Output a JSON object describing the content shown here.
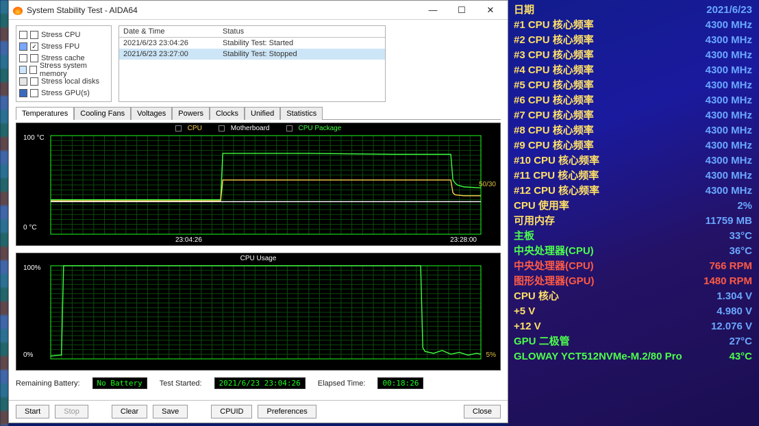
{
  "window": {
    "title": "System Stability Test - AIDA64",
    "min_glyph": "—",
    "max_glyph": "☐",
    "close_glyph": "✕"
  },
  "stress_options": [
    {
      "swatch": "#ffffff",
      "checked": false,
      "label": "Stress CPU"
    },
    {
      "swatch": "#7aa7ff",
      "checked": true,
      "label": "Stress FPU"
    },
    {
      "swatch": "#ffffff",
      "checked": false,
      "label": "Stress cache"
    },
    {
      "swatch": "#cce6ff",
      "checked": false,
      "label": "Stress system memory"
    },
    {
      "swatch": "#e6e6e6",
      "checked": false,
      "label": "Stress local disks"
    },
    {
      "swatch": "#3a6abf",
      "checked": false,
      "label": "Stress GPU(s)"
    }
  ],
  "log": {
    "headers": {
      "col1": "Date & Time",
      "col2": "Status"
    },
    "rows": [
      {
        "c1": "2021/6/23 23:04:26",
        "c2": "Stability Test: Started"
      },
      {
        "c1": "2021/6/23 23:27:00",
        "c2": "Stability Test: Stopped"
      }
    ]
  },
  "tabs": [
    "Temperatures",
    "Cooling Fans",
    "Voltages",
    "Powers",
    "Clocks",
    "Unified",
    "Statistics"
  ],
  "chart_data": [
    {
      "type": "line",
      "title": "",
      "legend": [
        "CPU",
        "Motherboard",
        "CPU Package"
      ],
      "legend_colors": [
        "#ffd050",
        "#ffffff",
        "#40ff40"
      ],
      "yticks": [
        "100 °C",
        "0 °C"
      ],
      "ylim": [
        0,
        100
      ],
      "xticks": [
        "23:04:26",
        "23:28:00"
      ],
      "side_value": "50/30",
      "series": [
        {
          "name": "CPU Package",
          "color": "#40ff40",
          "x": [
            0,
            0.39,
            0.395,
            0.4,
            0.6,
            0.8,
            0.93,
            0.935,
            0.94,
            0.945,
            0.96,
            1.0
          ],
          "y": [
            35,
            35,
            35,
            82,
            82,
            81,
            81,
            55,
            52,
            50,
            48,
            47
          ]
        },
        {
          "name": "CPU",
          "color": "#ffd050",
          "x": [
            0,
            0.39,
            0.395,
            0.4,
            0.6,
            0.8,
            0.93,
            0.935,
            0.94,
            0.96,
            1.0
          ],
          "y": [
            34,
            34,
            34,
            55,
            55,
            55,
            55,
            42,
            40,
            39,
            39
          ]
        },
        {
          "name": "Motherboard",
          "color": "#ffffff",
          "x": [
            0,
            1.0
          ],
          "y": [
            33,
            33
          ]
        }
      ]
    },
    {
      "type": "line",
      "title": "CPU Usage",
      "yticks": [
        "100%",
        "0%"
      ],
      "ylim": [
        0,
        100
      ],
      "side_value": "5%",
      "series": [
        {
          "name": "CPU Usage",
          "color": "#40ff40",
          "x": [
            0,
            0.02,
            0.025,
            0.03,
            0.86,
            0.865,
            0.87,
            0.89,
            0.91,
            0.93,
            0.95,
            0.97,
            0.99,
            1.0
          ],
          "y": [
            3,
            4,
            4,
            100,
            100,
            12,
            8,
            6,
            9,
            5,
            7,
            4,
            6,
            5
          ]
        }
      ]
    }
  ],
  "status": {
    "battery_label": "Remaining Battery:",
    "battery_value": "No Battery",
    "started_label": "Test Started:",
    "started_value": "2021/6/23 23:04:26",
    "elapsed_label": "Elapsed Time:",
    "elapsed_value": "00:18:26"
  },
  "buttons": {
    "start": "Start",
    "stop": "Stop",
    "clear": "Clear",
    "save": "Save",
    "cpuid": "CPUID",
    "preferences": "Preferences",
    "close": "Close"
  },
  "sensors": [
    {
      "label": "日期",
      "value": "2021/6/23",
      "cls": ""
    },
    {
      "label": "#1 CPU 核心频率",
      "value": "4300 MHz",
      "cls": ""
    },
    {
      "label": "#2 CPU 核心频率",
      "value": "4300 MHz",
      "cls": ""
    },
    {
      "label": "#3 CPU 核心频率",
      "value": "4300 MHz",
      "cls": ""
    },
    {
      "label": "#4 CPU 核心频率",
      "value": "4300 MHz",
      "cls": ""
    },
    {
      "label": "#5 CPU 核心频率",
      "value": "4300 MHz",
      "cls": ""
    },
    {
      "label": "#6 CPU 核心频率",
      "value": "4300 MHz",
      "cls": ""
    },
    {
      "label": "#7 CPU 核心频率",
      "value": "4300 MHz",
      "cls": ""
    },
    {
      "label": "#8 CPU 核心频率",
      "value": "4300 MHz",
      "cls": ""
    },
    {
      "label": "#9 CPU 核心频率",
      "value": "4300 MHz",
      "cls": ""
    },
    {
      "label": "#10 CPU 核心频率",
      "value": "4300 MHz",
      "cls": ""
    },
    {
      "label": "#11 CPU 核心频率",
      "value": "4300 MHz",
      "cls": ""
    },
    {
      "label": "#12 CPU 核心频率",
      "value": "4300 MHz",
      "cls": ""
    },
    {
      "label": "CPU 使用率",
      "value": "2%",
      "cls": ""
    },
    {
      "label": "可用内存",
      "value": "11759 MB",
      "cls": ""
    },
    {
      "label": "主板",
      "value": "33°C",
      "cls": "grn"
    },
    {
      "label": "中央处理器(CPU)",
      "value": "36°C",
      "cls": "grn"
    },
    {
      "label": "中央处理器(CPU)",
      "value": "766 RPM",
      "cls": "red"
    },
    {
      "label": "图形处理器(GPU)",
      "value": "1480 RPM",
      "cls": "red"
    },
    {
      "label": "CPU 核心",
      "value": "1.304 V",
      "cls": ""
    },
    {
      "label": "+5 V",
      "value": "4.980 V",
      "cls": ""
    },
    {
      "label": "+12 V",
      "value": "12.076 V",
      "cls": ""
    },
    {
      "label": "GPU 二极管",
      "value": "27°C",
      "cls": "grn"
    },
    {
      "label": "GLOWAY YCT512NVMe-M.2/80 Pro",
      "value": "43°C",
      "cls": "lastgrn grnv"
    }
  ]
}
